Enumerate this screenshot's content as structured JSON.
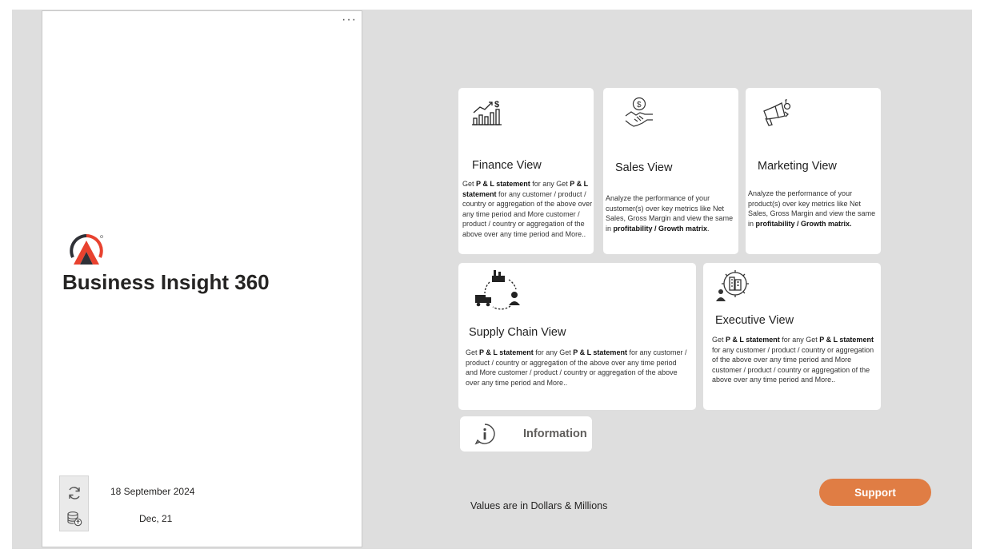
{
  "brand": {
    "title": "Business Insight 360"
  },
  "refresh": {
    "date": "18 September 2024",
    "period": "Dec, 21"
  },
  "cards": {
    "finance": {
      "title": "Finance View",
      "desc_p1": "Get ",
      "desc_b1": "P & L statement",
      "desc_p2": " for any Get ",
      "desc_b2": "P & L statement",
      "desc_p3": " for any customer / product / country or aggregation of the above over any time period and More customer / product / country or aggregation of the above over any time period and More.."
    },
    "sales": {
      "title": "Sales View",
      "desc_p1": "Analyze the performance of your customer(s) over key metrics like Net Sales, Gross Margin and view the same in ",
      "desc_b1": "profitability / Growth matrix",
      "desc_p2": "."
    },
    "marketing": {
      "title": "Marketing View",
      "desc_p1": "Analyze the performance of your product(s) over key metrics like Net Sales, Gross Margin and view the same in ",
      "desc_b1": "profitability / Growth matrix."
    },
    "supply_chain": {
      "title": "Supply Chain View",
      "desc_p1": "Get ",
      "desc_b1": "P & L statement",
      "desc_p2": " for any Get ",
      "desc_b2": "P & L statement",
      "desc_p3": " for any customer / product / country or aggregation of the above over any time period and More customer / product / country or aggregation of the above over any time period and More.."
    },
    "executive": {
      "title": "Executive View",
      "desc_p1": "Get ",
      "desc_b1": "P & L statement",
      "desc_p2": " for any Get ",
      "desc_b2": "P & L statement",
      "desc_p3": " for any customer / product / country or aggregation of the above over any time period and More customer / product / country or aggregation of the above over any time period and More.."
    }
  },
  "information": {
    "label": "Information"
  },
  "footnote": "Values are in Dollars & Millions",
  "support": {
    "label": "Support"
  },
  "colors": {
    "canvas": "#dedede",
    "accent": "#e07d44",
    "logo_dark": "#2f3137",
    "logo_red": "#e8422f"
  },
  "icons": [
    "more-options-icon",
    "brand-logo-icon",
    "refresh-icon",
    "database-upload-icon",
    "finance-chart-icon",
    "handshake-dollar-icon",
    "megaphone-social-icon",
    "supply-chain-cycle-icon",
    "executive-gear-building-icon",
    "info-icon"
  ]
}
